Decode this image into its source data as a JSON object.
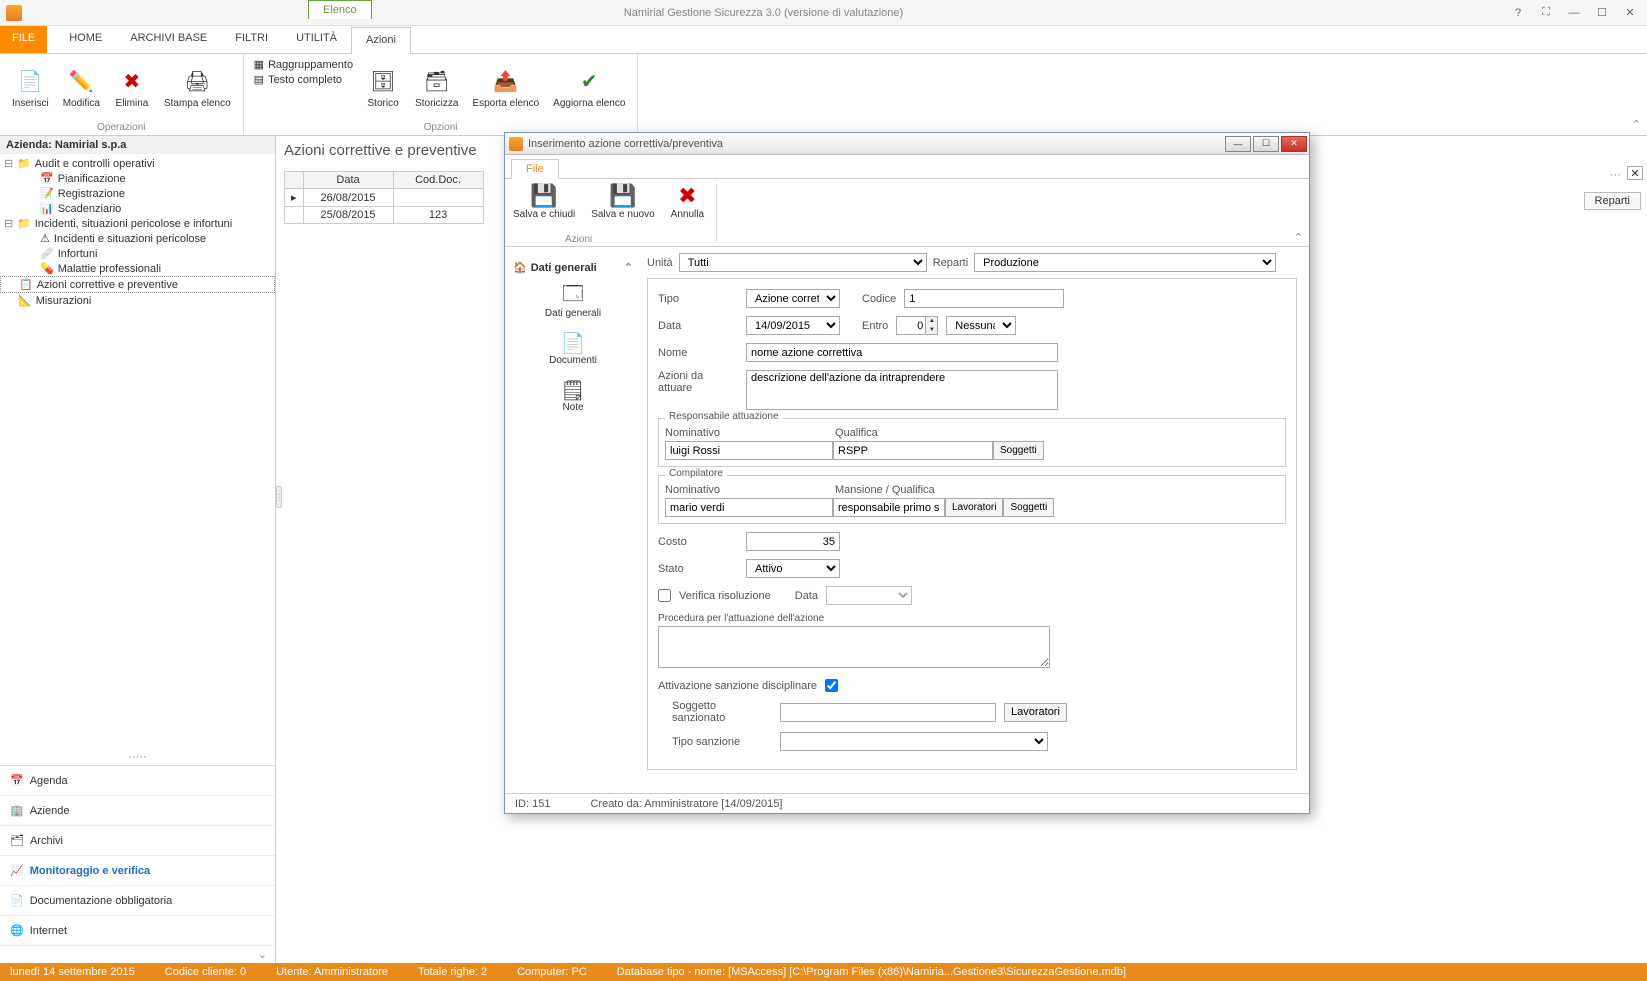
{
  "window": {
    "title": "Namirial Gestione Sicurezza 3.0 (versione di valutazione)",
    "context_tab": "Elenco"
  },
  "menubar": {
    "file": "FILE",
    "tabs": [
      "HOME",
      "ARCHIVI BASE",
      "FILTRI",
      "UTILITÀ",
      "Azioni"
    ]
  },
  "ribbon": {
    "operazioni": {
      "label": "Operazioni",
      "inserisci": "Inserisci",
      "modifica": "Modifica",
      "elimina": "Elimina",
      "stampa": "Stampa elenco"
    },
    "opts": {
      "raggruppamento": "Raggruppamento",
      "testo": "Testo completo"
    },
    "opzioni": {
      "label": "Opzioni",
      "storico": "Storico",
      "storicizza": "Storicizza",
      "esporta": "Esporta elenco",
      "aggiorna": "Aggiorna elenco"
    }
  },
  "tree": {
    "company": "Azienda: Namirial s.p.a",
    "audit": "Audit e controlli operativi",
    "pianificazione": "Pianificazione",
    "registrazione": "Registrazione",
    "scadenziario": "Scadenziario",
    "incidenti": "Incidenti, situazioni pericolose e infortuni",
    "incidenti_sit": "Incidenti e situazioni pericolose",
    "infortuni": "Infortuni",
    "malattie": "Malattie professionali",
    "azioni": "Azioni correttive e preventive",
    "misurazioni": "Misurazioni"
  },
  "bottomlinks": {
    "agenda": "Agenda",
    "aziende": "Aziende",
    "archivi": "Archivi",
    "monitoraggio": "Monitoraggio e verifica",
    "documentazione": "Documentazione obbligatoria",
    "internet": "Internet"
  },
  "content": {
    "heading": "Azioni correttive e preventive",
    "col_data": "Data",
    "col_cod": "Cod.Doc.",
    "rows": [
      {
        "data": "26/08/2015",
        "cod": ""
      },
      {
        "data": "25/08/2015",
        "cod": "123"
      }
    ],
    "reparti_btn": "Reparti",
    "more": "···"
  },
  "dialog": {
    "title": "Inserimento azione correttiva/preventiva",
    "tab_file": "File",
    "ribbon": {
      "salva_chiudi": "Salva e chiudi",
      "salva_nuovo": "Salva e nuovo",
      "annulla": "Annulla",
      "group": "Azioni"
    },
    "sidenav": {
      "header": "Dati generali",
      "dati": "Dati generali",
      "documenti": "Documenti",
      "note": "Note"
    },
    "top": {
      "unita_lbl": "Unità",
      "unita_val": "Tutti",
      "reparti_lbl": "Reparti",
      "reparti_val": "Produzione"
    },
    "form": {
      "tipo_lbl": "Tipo",
      "tipo_val": "Azione correttiva",
      "codice_lbl": "Codice",
      "codice_val": "1",
      "data_lbl": "Data",
      "data_val": "14/09/2015",
      "entro_lbl": "Entro",
      "entro_val": "0",
      "entro_unit": "Nessuna",
      "nome_lbl": "Nome",
      "nome_val": "nome azione correttiva",
      "azioni_lbl": "Azioni da attuare",
      "azioni_val": "descrizione dell'azione da intraprendere",
      "resp_title": "Responsabile attuazione",
      "nominativo_lbl": "Nominativo",
      "qualifica_lbl": "Qualifica",
      "resp_nom": "luigi Rossi",
      "resp_qual": "RSPP",
      "soggetti_btn": "Soggetti",
      "comp_title": "Compilatore",
      "mansione_lbl": "Mansione / Qualifica",
      "comp_nom": "mario verdi",
      "comp_mans": "responsabile primo soccorso",
      "lavoratori_btn": "Lavoratori",
      "costo_lbl": "Costo",
      "costo_val": "35",
      "stato_lbl": "Stato",
      "stato_val": "Attivo",
      "verifica_lbl": "Verifica risoluzione",
      "verifica_data_lbl": "Data",
      "proc_lbl": "Procedura per l'attuazione dell'azione",
      "sanz_lbl": "Attivazione sanzione disciplinare",
      "sogg_sanz_lbl": "Soggetto sanzionato",
      "tipo_sanz_lbl": "Tipo sanzione"
    },
    "footer": {
      "id": "ID: 151",
      "creato": "Creato da: Amministratore [14/09/2015]"
    }
  },
  "statusbar": {
    "date": "lunedì 14 settembre 2015",
    "codice": "Codice cliente: 0",
    "utente": "Utente: Amministratore",
    "totale": "Totale righe: 2",
    "computer": "Computer: PC",
    "db": "Database tipo - nome: [MSAccess] [C:\\Program Files (x86)\\Namiria...Gestione3\\SicurezzaGestione.mdb]"
  }
}
